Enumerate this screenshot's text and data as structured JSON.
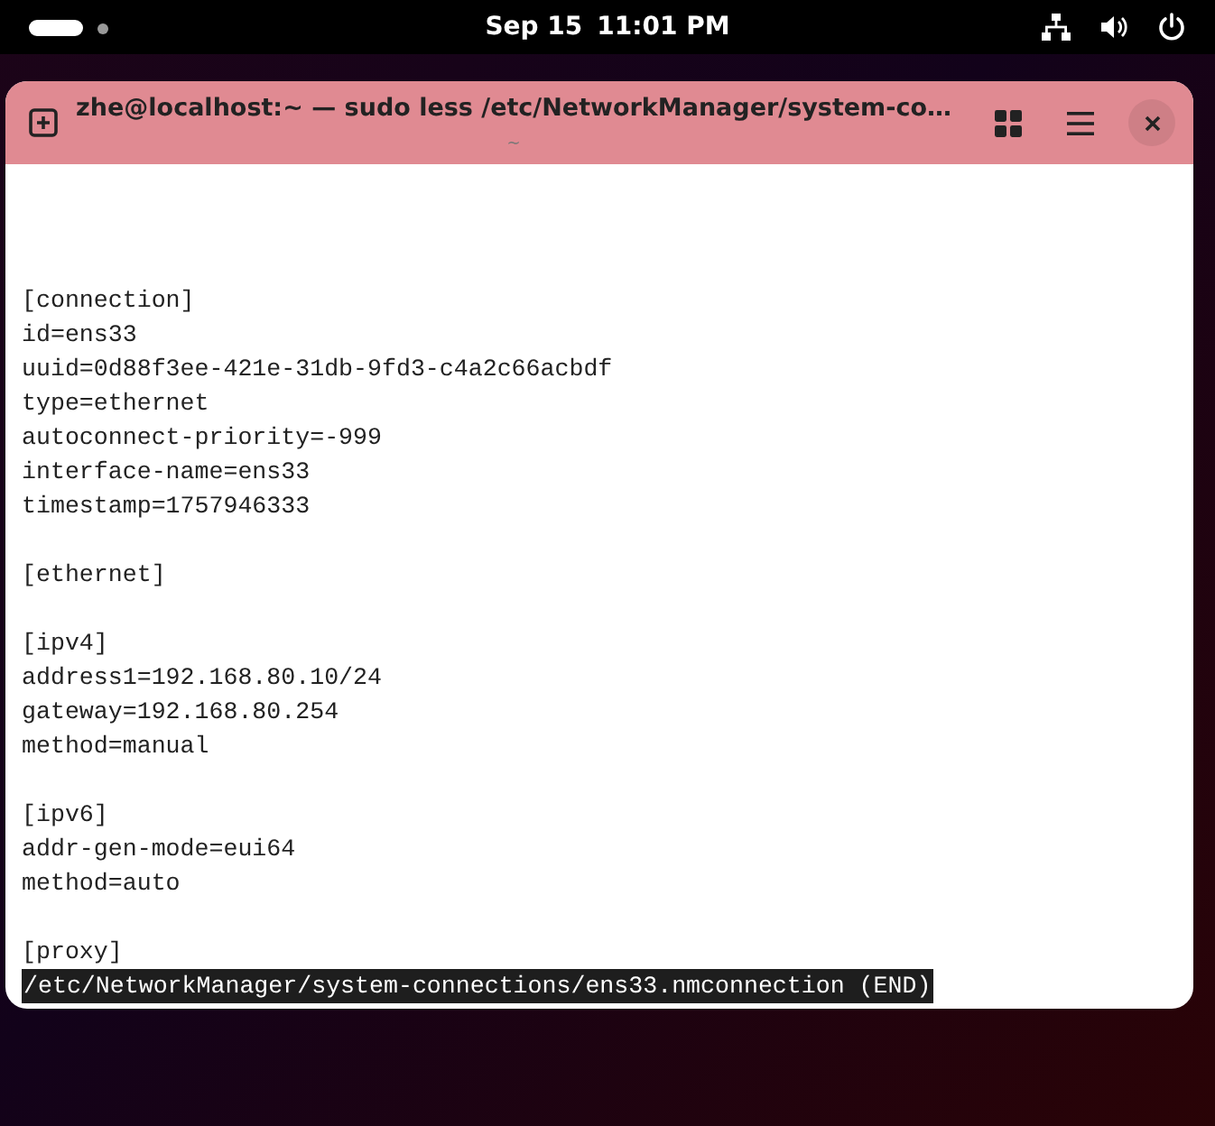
{
  "top_bar": {
    "date": "Sep 15",
    "time": "11:01 PM"
  },
  "window": {
    "title": "zhe@localhost:~ — sudo less /etc/NetworkManager/system-co…",
    "subtitle": "~"
  },
  "terminal": {
    "sections": [
      {
        "lines": [
          "[connection]",
          "id=ens33",
          "uuid=0d88f3ee-421e-31db-9fd3-c4a2c66acbdf",
          "type=ethernet",
          "autoconnect-priority=-999",
          "interface-name=ens33",
          "timestamp=1757946333"
        ]
      },
      {
        "lines": [
          "[ethernet]"
        ]
      },
      {
        "lines": [
          "[ipv4]",
          "address1=192.168.80.10/24",
          "gateway=192.168.80.254",
          "method=manual"
        ]
      },
      {
        "lines": [
          "[ipv6]",
          "addr-gen-mode=eui64",
          "method=auto"
        ]
      },
      {
        "lines": [
          "[proxy]"
        ]
      }
    ],
    "status_line": "/etc/NetworkManager/system-connections/ens33.nmconnection (END)"
  }
}
